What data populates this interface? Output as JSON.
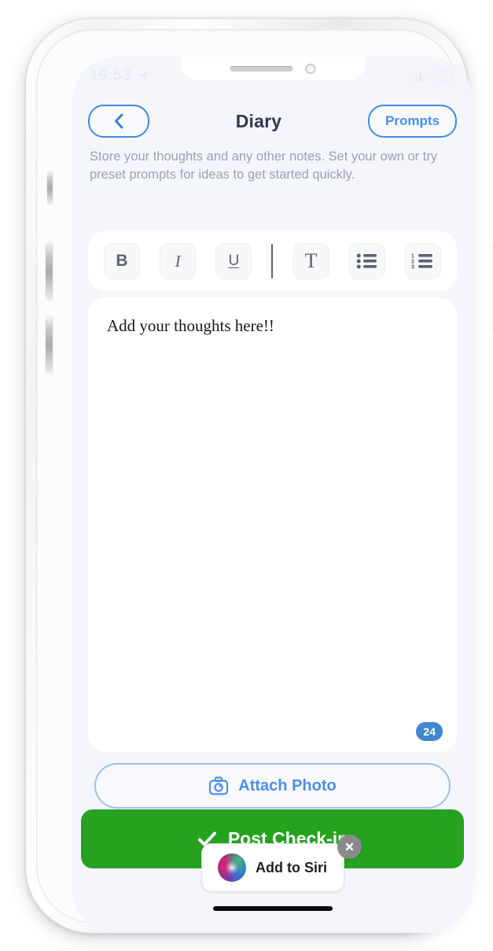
{
  "status_bar": {
    "time": "19:53",
    "location_icon": "location-arrow-icon",
    "signal_icon": "cellular-signal-icon",
    "battery_icon": "battery-icon"
  },
  "header": {
    "back_icon": "chevron-left-icon",
    "title": "Diary",
    "prompts_label": "Prompts"
  },
  "description": {
    "text": "Store your thoughts and any other notes. Set your own or try preset prompts for ideas to get started quickly."
  },
  "toolbar": {
    "bold_label": "B",
    "italic_label": "I",
    "underline_label": "U",
    "font_label": "T",
    "bullet_list_icon": "bulleted-list-icon",
    "numbered_list_icon": "numbered-list-icon",
    "numbered_list_digits": [
      "1",
      "2",
      "3"
    ]
  },
  "editor": {
    "content": "Add your thoughts here!!",
    "char_count": "24"
  },
  "actions": {
    "attach_photo_label": "Attach Photo",
    "attach_photo_icon": "camera-icon",
    "post_checkin_label": "Post Check-in",
    "post_checkin_icon": "checkmark-icon",
    "post_checkin_color": "#26a120"
  },
  "siri": {
    "label": "Add to Siri",
    "orb_icon": "siri-orb-icon",
    "close_icon": "close-x-icon"
  },
  "colors": {
    "accent_blue": "#4285d0",
    "border_blue": "#3f8ae0",
    "screen_bg": "#f4f6fb",
    "badge_blue": "#4285d0",
    "green": "#26a120"
  }
}
